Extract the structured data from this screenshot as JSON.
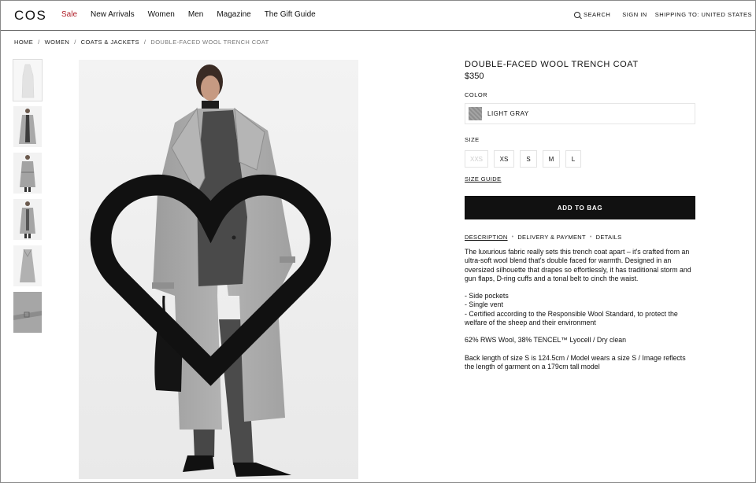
{
  "header": {
    "logo": "COS",
    "nav": [
      "Sale",
      "New Arrivals",
      "Women",
      "Men",
      "Magazine",
      "The Gift Guide"
    ],
    "search_label": "SEARCH",
    "signin_label": "SIGN IN",
    "shipping_label": "SHIPPING TO: UNITED STATES"
  },
  "breadcrumb": [
    "HOME",
    "WOMEN",
    "COATS & JACKETS",
    "DOUBLE-FACED WOOL TRENCH COAT"
  ],
  "product": {
    "title": "DOUBLE-FACED WOOL TRENCH COAT",
    "price": "$350",
    "color_label": "COLOR",
    "color_value": "LIGHT GRAY",
    "size_label": "SIZE",
    "sizes": [
      "XXS",
      "XS",
      "S",
      "M",
      "L"
    ],
    "size_guide": "SIZE GUIDE",
    "add_to_bag": "ADD TO BAG",
    "tabs": [
      "DESCRIPTION",
      "DELIVERY & PAYMENT",
      "DETAILS"
    ],
    "description": [
      "The luxurious fabric really sets this trench coat apart – it's crafted from an ultra-soft wool blend that's double faced for warmth. Designed in an oversized silhouette that drapes so effortlessly, it has traditional storm and gun flaps, D-ring cuffs and a tonal belt to cinch the waist.",
      "- Side pockets\n- Single vent\n- Certified according to the Responsible Wool Standard, to protect the welfare of the sheep and their environment",
      "62% RWS Wool, 38% TENCEL™ Lyocell / Dry clean",
      "Back length of size S is 124.5cm / Model wears a size S / Image reflects the length of garment on a 179cm tall model"
    ]
  },
  "colors": {
    "sale": "#b0202a",
    "coat": "#a4a4a4",
    "button": "#111111"
  }
}
